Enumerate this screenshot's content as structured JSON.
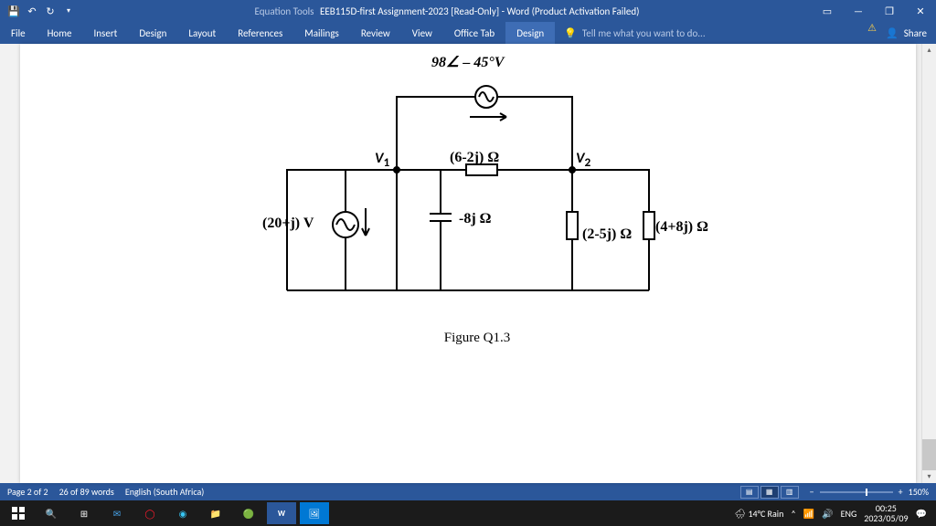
{
  "titlebar": {
    "equation_tools": "Equation Tools",
    "title": "EEB115D-first Assignment-2023 [Read-Only] - Word (Product Activation Failed)"
  },
  "tabs": {
    "file": "File",
    "home": "Home",
    "insert": "Insert",
    "design": "Design",
    "layout": "Layout",
    "references": "References",
    "mailings": "Mailings",
    "review": "Review",
    "view": "View",
    "office": "Office Tab",
    "ctx_design": "Design",
    "tellme": "Tell me what you want to do...",
    "share": "Share"
  },
  "circuit": {
    "top_source": "98∠ – 45°V",
    "v1": "V",
    "v1_sub": "1",
    "v2": "V",
    "v2_sub": "2",
    "z_top": "(6-2j) Ω",
    "src_left": "(20+j) V",
    "z_cap": "-8j Ω",
    "z_mid": "(2-5j) Ω",
    "z_right": "(4+8j) Ω",
    "caption": "Figure Q1.3"
  },
  "status": {
    "page": "Page 2 of 2",
    "words": "26 of 89 words",
    "lang": "English (South Africa)",
    "zoom": "150%"
  },
  "taskbar": {
    "weather": "14°C  Rain",
    "lang": "ENG",
    "time": "00:25",
    "date": "2023/05/09"
  }
}
